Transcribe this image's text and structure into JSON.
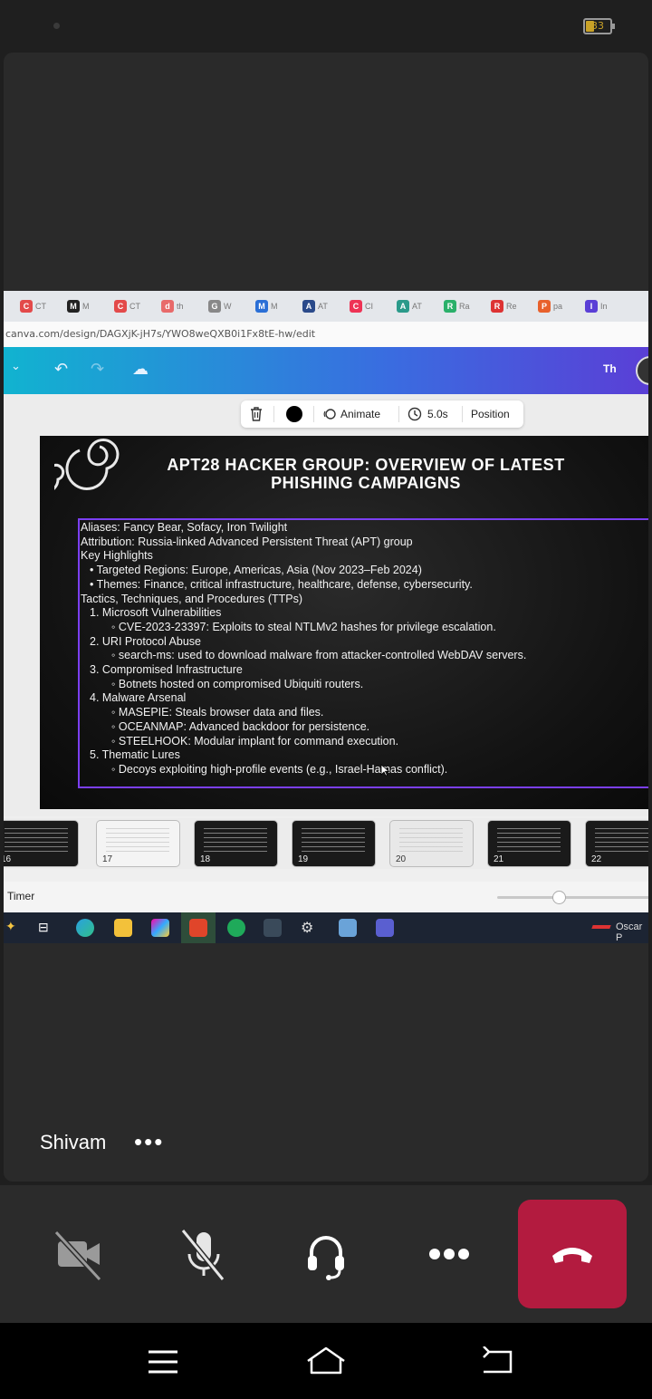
{
  "status": {
    "battery": "33"
  },
  "browser": {
    "tabs": [
      {
        "icon": "C",
        "label": "CT",
        "color": "#e34a4a"
      },
      {
        "icon": "M",
        "label": "M",
        "color": "#222"
      },
      {
        "icon": "C",
        "label": "CT",
        "color": "#e34a4a"
      },
      {
        "icon": "d",
        "label": "th",
        "color": "#e86a6a"
      },
      {
        "icon": "G",
        "label": "W",
        "color": "#888"
      },
      {
        "icon": "M",
        "label": "M",
        "color": "#2a6fd6"
      },
      {
        "icon": "A",
        "label": "AT",
        "color": "#2a4a8a"
      },
      {
        "icon": "C",
        "label": "CI",
        "color": "#e35"
      },
      {
        "icon": "A",
        "label": "AT",
        "color": "#2a9a8a"
      },
      {
        "icon": "R",
        "label": "Ra",
        "color": "#2ab06a"
      },
      {
        "icon": "R",
        "label": "Re",
        "color": "#d33"
      },
      {
        "icon": "P",
        "label": "pa",
        "color": "#e8612c"
      },
      {
        "icon": "I",
        "label": "In",
        "color": "#5a3fd6"
      }
    ],
    "url": "canva.com/design/DAGXjK-jH7s/YWO8weQXB0i1Fx8tE-hw/edit"
  },
  "canva": {
    "user_initials": "Th",
    "toolbar": {
      "animate": "Animate",
      "duration": "5.0s",
      "position": "Position"
    }
  },
  "slide": {
    "title_line1": "APT28 HACKER GROUP: OVERVIEW OF LATEST",
    "title_line2": "PHISHING CAMPAIGNS",
    "lines": [
      "Aliases: Fancy Bear, Sofacy, Iron Twilight",
      "Attribution: Russia-linked Advanced Persistent Threat (APT) group",
      "Key Highlights",
      "•  Targeted Regions: Europe, Americas, Asia (Nov 2023–Feb 2024)",
      "•  Themes: Finance, critical infrastructure, healthcare, defense, cybersecurity.",
      "Tactics, Techniques, and Procedures (TTPs)",
      "1. Microsoft Vulnerabilities",
      "◦  CVE-2023-23397: Exploits to steal NTLMv2 hashes for privilege escalation.",
      "2. URI Protocol Abuse",
      "◦  search-ms: used to download malware from attacker-controlled WebDAV servers.",
      "3. Compromised Infrastructure",
      "◦  Botnets hosted on compromised Ubiquiti routers.",
      "4. Malware Arsenal",
      "◦  MASEPIE: Steals browser data and files.",
      "◦  OCEANMAP: Advanced backdoor for persistence.",
      "◦  STEELHOOK: Modular implant for command execution.",
      "5. Thematic Lures",
      "◦  Decoys exploiting high-profile events (e.g., Israel-Hamas conflict)."
    ]
  },
  "thumbnails": [
    "16",
    "17",
    "18",
    "19",
    "20",
    "21",
    "22"
  ],
  "timer_label": "Timer",
  "taskbar": {
    "user": "Oscar P"
  },
  "participant": {
    "name": "Shivam",
    "more": "•••"
  },
  "call_controls": {
    "camera": "camera-off",
    "mic": "mic-off",
    "audio": "headset",
    "more": "more",
    "end": "end-call"
  },
  "colors": {
    "end_call": "#b31b3f",
    "textbox_border": "#7b3ff2",
    "canva_gradient_start": "#11b3d0",
    "canva_gradient_end": "#5a3fd6"
  }
}
